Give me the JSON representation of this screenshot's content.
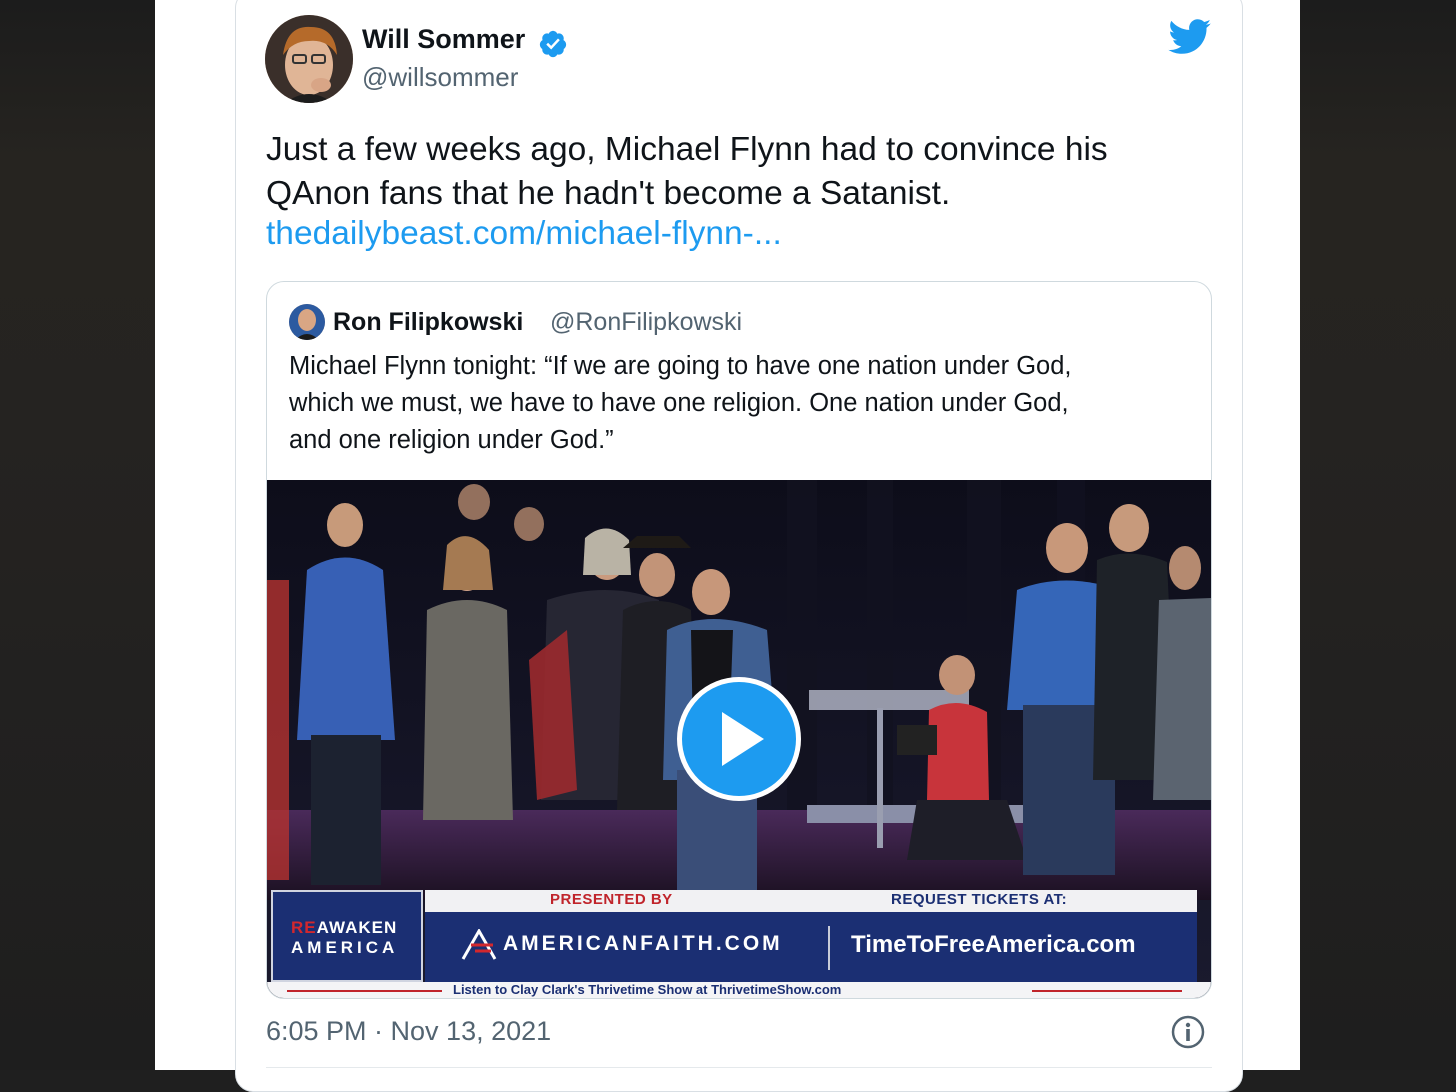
{
  "tweet": {
    "author_name": "Will Sommer",
    "author_handle": "@willsommer",
    "text_lines": [
      "Just a few weeks ago, Michael Flynn had to convince his",
      "QAnon fans that he hadn't become a Satanist."
    ],
    "link": "thedailybeast.com/michael-flynn-...",
    "timestamp": "6:05 PM · Nov 13, 2021"
  },
  "quote": {
    "author_name": "Ron Filipkowski",
    "author_handle": "@RonFilipkowski",
    "text_lines": [
      "Michael Flynn tonight: “If we are going to have one nation under God,",
      "which we must, we have to have one religion. One nation under God,",
      "and one religion under God.”"
    ]
  },
  "video": {
    "banner": {
      "brand_re": "RE",
      "brand_line1": "AWAKEN",
      "brand_line2": "AMERICA",
      "presented_by": "PRESENTED BY",
      "request_tickets": "REQUEST TICKETS AT:",
      "sponsor": "AMERICANFAITH.COM",
      "tickets_site": "TimeToFreeAmerica.com",
      "ticker": "Listen to Clay Clark's Thrivetime Show at ThrivetimeShow.com"
    }
  },
  "icons": {
    "verified": "verified-badge-icon",
    "twitter": "twitter-bird-icon",
    "play": "play-icon",
    "info": "info-icon"
  },
  "colors": {
    "accent": "#1d9bf0",
    "text": "#0f1419",
    "secondary": "#536471",
    "banner_blue": "#1b2f73",
    "banner_red": "#c0242b"
  }
}
